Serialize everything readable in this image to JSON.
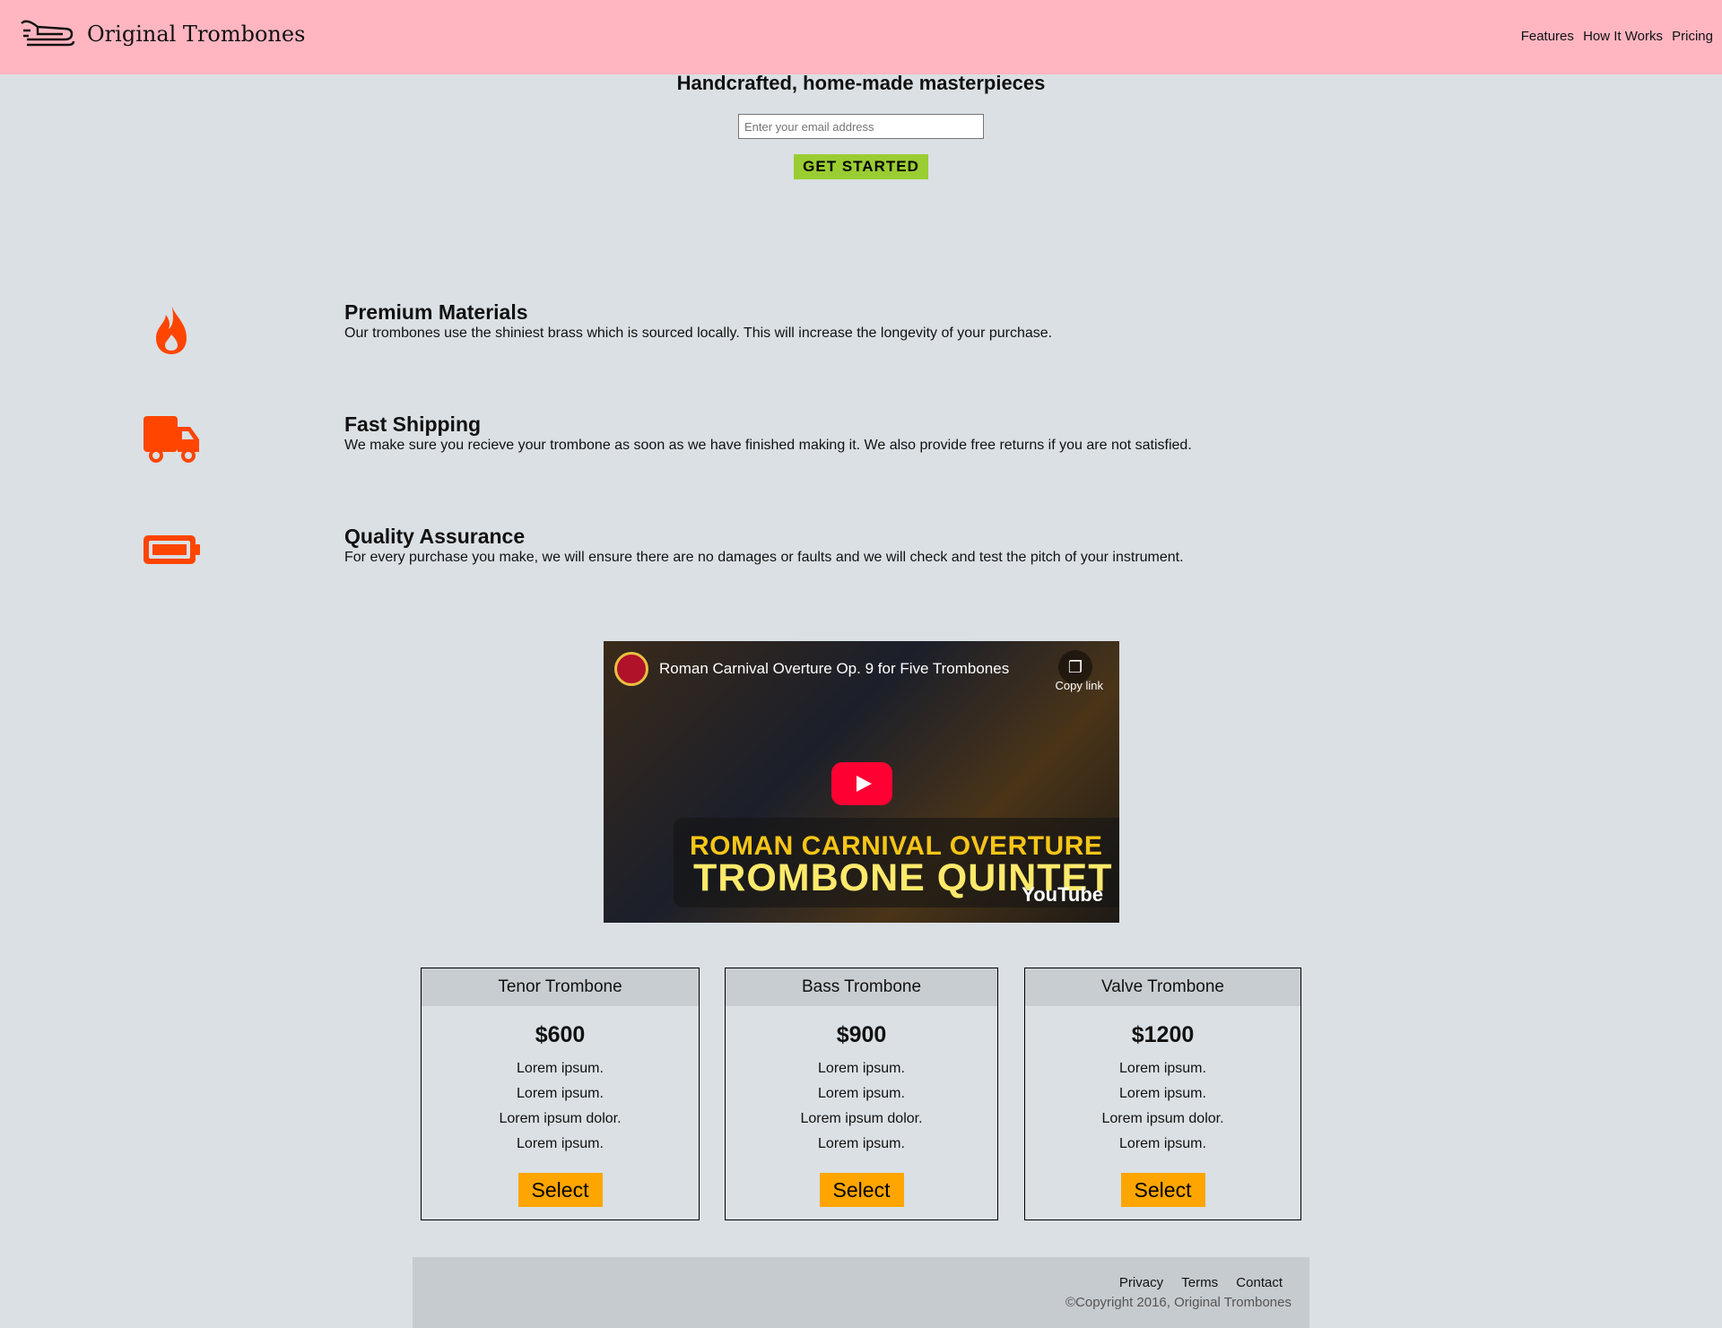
{
  "header": {
    "brand": "Original Trombones",
    "nav": [
      "Features",
      "How It Works",
      "Pricing"
    ]
  },
  "hero": {
    "title": "Handcrafted, home-made masterpieces",
    "email_placeholder": "Enter your email address",
    "cta": "GET STARTED"
  },
  "features": [
    {
      "icon": "fire-icon",
      "title": "Premium Materials",
      "desc": "Our trombones use the shiniest brass which is sourced locally. This will increase the longevity of your purchase."
    },
    {
      "icon": "truck-icon",
      "title": "Fast Shipping",
      "desc": "We make sure you recieve your trombone as soon as we have finished making it. We also provide free returns if you are not satisfied."
    },
    {
      "icon": "battery-icon",
      "title": "Quality Assurance",
      "desc": "For every purchase you make, we will ensure there are no damages or faults and we will check and test the pitch of your instrument."
    }
  ],
  "video": {
    "title": "Roman Carnival Overture Op. 9 for Five Trombones",
    "copy_link": "Copy link",
    "banner_line1": "ROMAN CARNIVAL OVERTURE",
    "banner_line2": "TROMBONE QUINTET",
    "platform": "YouTube"
  },
  "pricing": [
    {
      "name": "Tenor Trombone",
      "price": "$600",
      "lines": [
        "Lorem ipsum.",
        "Lorem ipsum.",
        "Lorem ipsum dolor.",
        "Lorem ipsum."
      ],
      "button": "Select"
    },
    {
      "name": "Bass Trombone",
      "price": "$900",
      "lines": [
        "Lorem ipsum.",
        "Lorem ipsum.",
        "Lorem ipsum dolor.",
        "Lorem ipsum."
      ],
      "button": "Select"
    },
    {
      "name": "Valve Trombone",
      "price": "$1200",
      "lines": [
        "Lorem ipsum.",
        "Lorem ipsum.",
        "Lorem ipsum dolor.",
        "Lorem ipsum."
      ],
      "button": "Select"
    }
  ],
  "footer": {
    "links": [
      "Privacy",
      "Terms",
      "Contact"
    ],
    "copyright": "©Copyright 2016, Original Trombones"
  },
  "colors": {
    "header_bg": "#ffb6c1",
    "page_bg": "#dae0e4",
    "accent_icon": "#ff4500",
    "cta_bg": "#9acd32",
    "select_bg": "#ffa500"
  }
}
